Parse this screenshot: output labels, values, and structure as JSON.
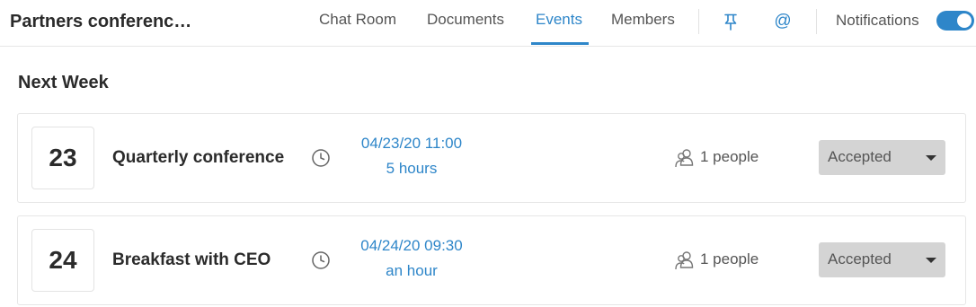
{
  "header": {
    "title": "Partners conferenc…",
    "tabs": [
      {
        "label": "Chat Room",
        "active": false
      },
      {
        "label": "Documents",
        "active": false
      },
      {
        "label": "Events",
        "active": true
      },
      {
        "label": "Members",
        "active": false
      }
    ],
    "icons": {
      "pin": "pin-icon",
      "mention": "@"
    },
    "notifications": {
      "label": "Notifications",
      "enabled": true
    }
  },
  "section": {
    "title": "Next Week"
  },
  "events": [
    {
      "day": "23",
      "title": "Quarterly conference",
      "datetime": "04/23/20 11:00",
      "duration": "5 hours",
      "people": "1 people",
      "status": "Accepted"
    },
    {
      "day": "24",
      "title": "Breakfast with CEO",
      "datetime": "04/24/20 09:30",
      "duration": "an hour",
      "people": "1 people",
      "status": "Accepted"
    }
  ],
  "colors": {
    "accent": "#2e86c9",
    "select_bg": "#d4d4d4",
    "border": "#e6e6e6"
  }
}
